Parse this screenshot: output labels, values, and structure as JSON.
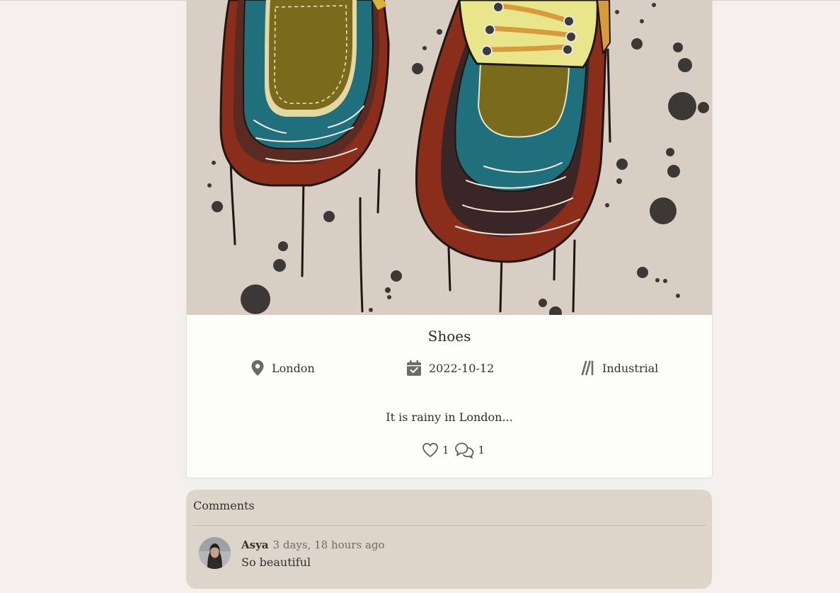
{
  "post": {
    "image_alt": "Watercolor illustration of two shoes with ink drips",
    "title": "Shoes",
    "location": "London",
    "date": "2022-10-12",
    "style": "Industrial",
    "description": "It is rainy in London...",
    "likes": "1",
    "comments_count": "1",
    "icons": {
      "location": "map-pin-icon",
      "date": "calendar-check-icon",
      "style": "slashes-icon",
      "likes": "heart-icon",
      "comments": "chat-bubbles-icon"
    }
  },
  "comments": {
    "heading": "Comments",
    "items": [
      {
        "author": "Asya",
        "time": "3 days, 18 hours ago",
        "text": "So beautiful"
      }
    ]
  },
  "colors": {
    "page_bg": "#f3f0eb",
    "card_bg": "#fdfdfb",
    "comments_bg": "#ddd5ca",
    "icon": "#6a6a6a"
  }
}
